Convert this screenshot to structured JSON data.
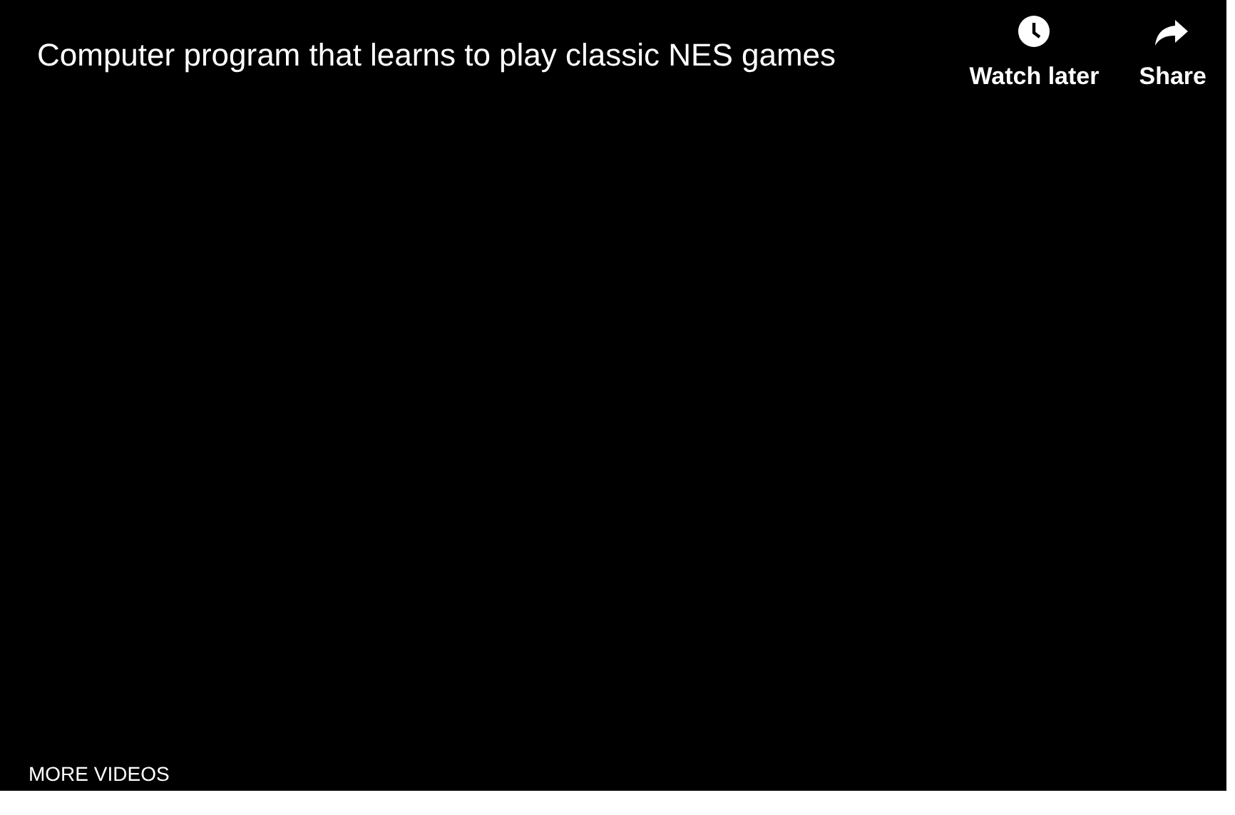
{
  "video": {
    "title": "Computer program that learns to play classic NES games"
  },
  "actions": [
    {
      "kind": "clock",
      "label": "Watch later"
    },
    {
      "kind": "share",
      "label": "Share"
    }
  ],
  "more_videos": "MORE VIDEOS"
}
